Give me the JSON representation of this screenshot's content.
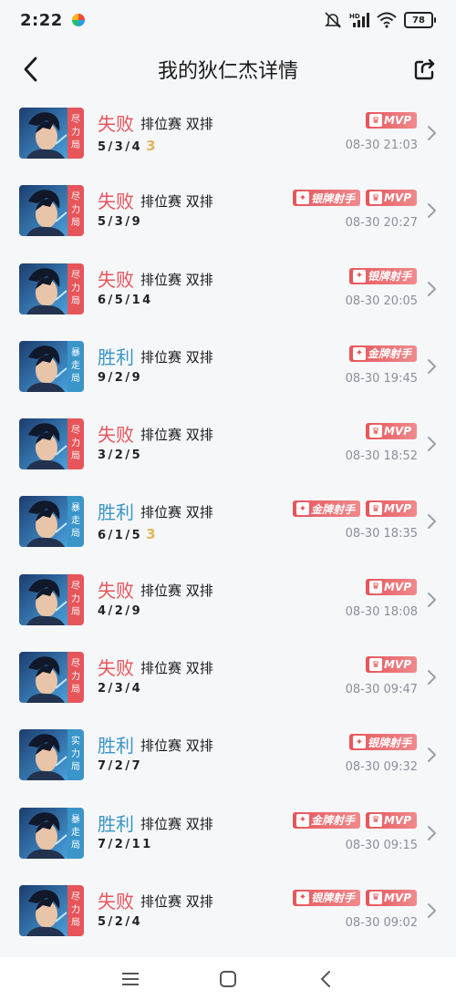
{
  "status_bar": {
    "time": "2:22",
    "battery": "78",
    "signal_label": "HD"
  },
  "header": {
    "title": "我的狄仁杰详情"
  },
  "colors": {
    "loss": "#e6555a",
    "win": "#3a95c9",
    "tag_red": "#e6555a",
    "tag_blue": "#3a95c9",
    "gold_count": "#e0b75a"
  },
  "rows": [
    {
      "mode": [
        "尽",
        "力",
        "局"
      ],
      "mode_color": "red",
      "result": "失败",
      "result_type": "loss",
      "match": "排位赛 双排",
      "kda": "5/3/4",
      "count": "3",
      "badges": [
        "MVP"
      ],
      "time": "08-30 21:03"
    },
    {
      "mode": [
        "尽",
        "力",
        "局"
      ],
      "mode_color": "red",
      "result": "失败",
      "result_type": "loss",
      "match": "排位赛 双排",
      "kda": "5/3/9",
      "count": "",
      "badges": [
        "银牌射手",
        "MVP"
      ],
      "time": "08-30 20:27"
    },
    {
      "mode": [
        "尽",
        "力",
        "局"
      ],
      "mode_color": "red",
      "result": "失败",
      "result_type": "loss",
      "match": "排位赛 双排",
      "kda": "6/5/14",
      "count": "",
      "badges": [
        "银牌射手"
      ],
      "time": "08-30 20:05"
    },
    {
      "mode": [
        "暴",
        "走",
        "局"
      ],
      "mode_color": "blue",
      "result": "胜利",
      "result_type": "win",
      "match": "排位赛 双排",
      "kda": "9/2/9",
      "count": "",
      "badges": [
        "金牌射手"
      ],
      "time": "08-30 19:45"
    },
    {
      "mode": [
        "尽",
        "力",
        "局"
      ],
      "mode_color": "red",
      "result": "失败",
      "result_type": "loss",
      "match": "排位赛 双排",
      "kda": "3/2/5",
      "count": "",
      "badges": [
        "MVP"
      ],
      "time": "08-30 18:52"
    },
    {
      "mode": [
        "暴",
        "走",
        "局"
      ],
      "mode_color": "blue",
      "result": "胜利",
      "result_type": "win",
      "match": "排位赛 双排",
      "kda": "6/1/5",
      "count": "3",
      "badges": [
        "金牌射手",
        "MVP"
      ],
      "time": "08-30 18:35"
    },
    {
      "mode": [
        "尽",
        "力",
        "局"
      ],
      "mode_color": "red",
      "result": "失败",
      "result_type": "loss",
      "match": "排位赛 双排",
      "kda": "4/2/9",
      "count": "",
      "badges": [
        "MVP"
      ],
      "time": "08-30 18:08"
    },
    {
      "mode": [
        "尽",
        "力",
        "局"
      ],
      "mode_color": "red",
      "result": "失败",
      "result_type": "loss",
      "match": "排位赛 双排",
      "kda": "2/3/4",
      "count": "",
      "badges": [
        "MVP"
      ],
      "time": "08-30 09:47"
    },
    {
      "mode": [
        "实",
        "力",
        "局"
      ],
      "mode_color": "blue",
      "result": "胜利",
      "result_type": "win",
      "match": "排位赛 双排",
      "kda": "7/2/7",
      "count": "",
      "badges": [
        "银牌射手"
      ],
      "time": "08-30 09:32"
    },
    {
      "mode": [
        "暴",
        "走",
        "局"
      ],
      "mode_color": "blue",
      "result": "胜利",
      "result_type": "win",
      "match": "排位赛 双排",
      "kda": "7/2/11",
      "count": "",
      "badges": [
        "金牌射手",
        "MVP"
      ],
      "time": "08-30 09:15"
    },
    {
      "mode": [
        "尽",
        "力",
        "局"
      ],
      "mode_color": "red",
      "result": "失败",
      "result_type": "loss",
      "match": "排位赛 双排",
      "kda": "5/2/4",
      "count": "",
      "badges": [
        "银牌射手",
        "MVP"
      ],
      "time": "08-30 09:02"
    }
  ],
  "icons": {
    "back": "chevron-left-icon",
    "share": "share-icon",
    "row_arrow": "chevron-right-icon",
    "nav_menu": "menu-icon",
    "nav_home": "home-icon",
    "nav_back": "back-icon"
  }
}
